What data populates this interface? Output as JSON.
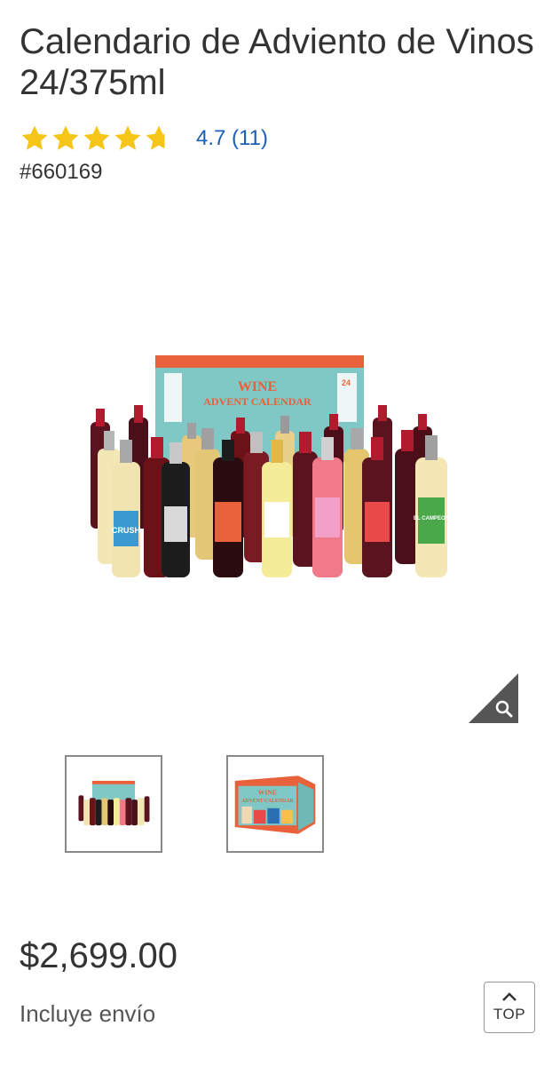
{
  "product": {
    "title": "Calendario de Adviento de Vinos 24/375ml",
    "rating_text": "4.7 (11)",
    "rating_value": 4.7,
    "rating_max": 5,
    "sku": "#660169",
    "price": "$2,699.00",
    "shipping_note": "Incluye envío"
  },
  "gallery": {
    "box_label_line1": "WINE",
    "box_label_line2": "ADVENT CALENDAR",
    "box_badge": "24",
    "zoom_icon": "magnifier-icon",
    "thumbnails": [
      "bottles-lineup",
      "calendar-box"
    ],
    "bottle_labels": [
      "CRUSH",
      "EL CAMPEON"
    ]
  },
  "controls": {
    "top_label": "TOP",
    "top_icon": "chevron-up-icon"
  },
  "colors": {
    "star": "#f5c518",
    "link": "#1a5fb4",
    "box_teal": "#7fc8c6",
    "box_orange": "#e8613a"
  }
}
